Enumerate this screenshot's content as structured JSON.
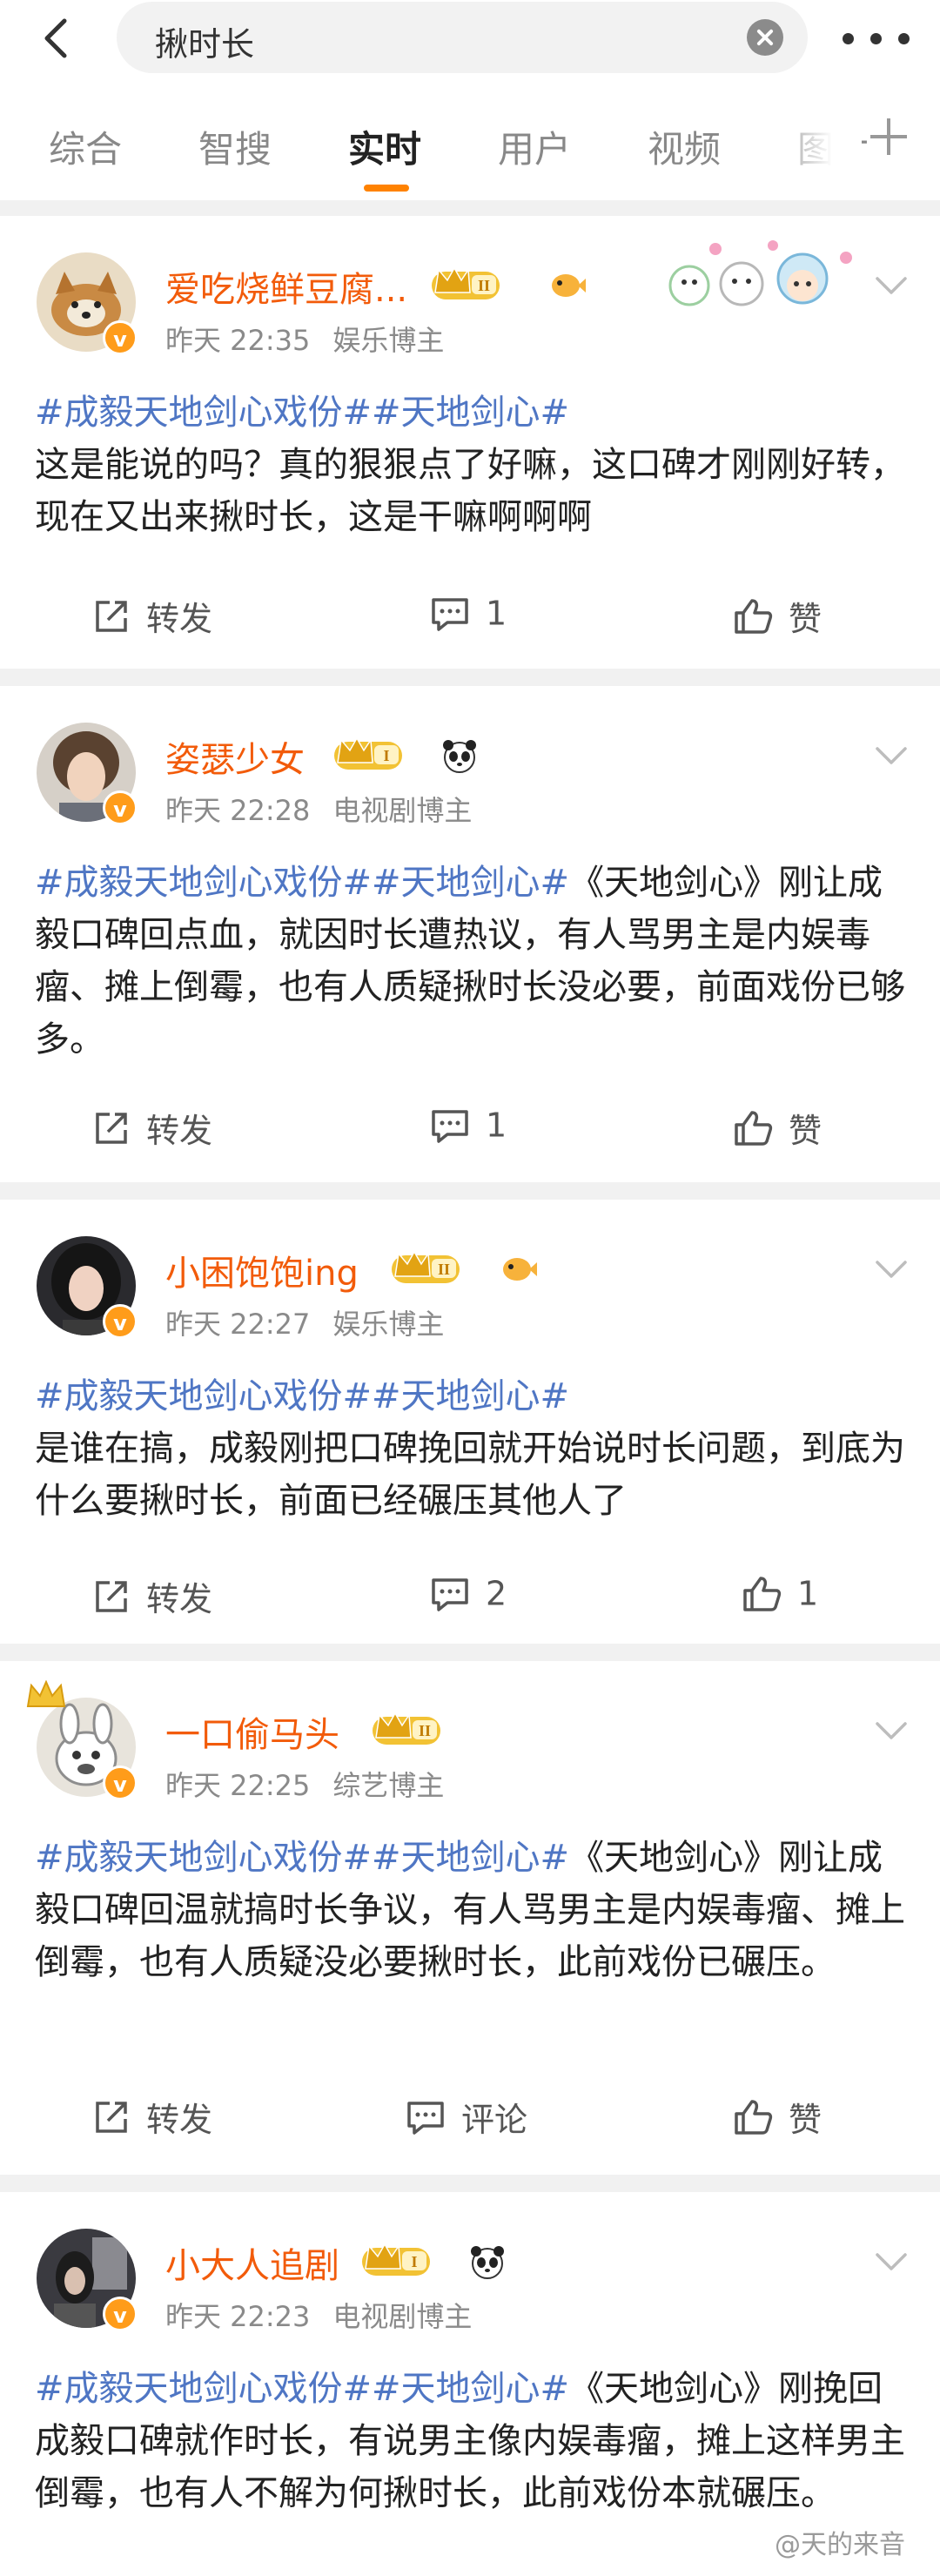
{
  "search": {
    "query": "揪时长"
  },
  "tabs": [
    "综合",
    "智搜",
    "实时",
    "用户",
    "视频",
    "图片"
  ],
  "active_tab": "实时",
  "accent_color": "#ff8200",
  "username_color": "#f25b0a",
  "hashtag_color": "#4f76c4",
  "posts": [
    {
      "username": "爱吃烧鲜豆腐...",
      "time": "昨天 22:35",
      "role": "娱乐博主",
      "level": "II",
      "hashtags": "#成毅天地剑心戏份##天地剑心#",
      "text": "这是能说的吗？真的狠狠点了好嘛，这口碑才刚刚好转，现在又出来揪时长，这是干嘛啊啊啊",
      "repost": "转发",
      "comment": "1",
      "like": "赞"
    },
    {
      "username": "姿瑟少女",
      "time": "昨天 22:28",
      "role": "电视剧博主",
      "level": "I",
      "hashtags": "#成毅天地剑心戏份##天地剑心#",
      "text": "《天地剑心》刚让成毅口碑回点血，就因时长遭热议，有人骂男主是内娱毒瘤、摊上倒霉，也有人质疑揪时长没必要，前面戏份已够多。",
      "repost": "转发",
      "comment": "1",
      "like": "赞"
    },
    {
      "username": "小困饱饱ing",
      "time": "昨天 22:27",
      "role": "娱乐博主",
      "level": "II",
      "hashtags": "#成毅天地剑心戏份##天地剑心#",
      "text": "是谁在搞，成毅刚把口碑挽回就开始说时长问题，到底为什么要揪时长，前面已经碾压其他人了",
      "repost": "转发",
      "comment": "2",
      "like": "1"
    },
    {
      "username": "一口偷马头",
      "time": "昨天 22:25",
      "role": "综艺博主",
      "level": "II",
      "hashtags": "#成毅天地剑心戏份##天地剑心#",
      "text": "《天地剑心》刚让成毅口碑回温就搞时长争议，有人骂男主是内娱毒瘤、摊上倒霉，也有人质疑没必要揪时长，此前戏份已碾压。",
      "repost": "转发",
      "comment": "评论",
      "like": "赞"
    },
    {
      "username": "小大人追剧",
      "time": "昨天 22:23",
      "role": "电视剧博主",
      "level": "I",
      "hashtags": "#成毅天地剑心戏份##天地剑心#",
      "text": "《天地剑心》刚挽回成毅口碑就作时长，有说男主像内娱毒瘤，摊上这样男主倒霉，也有人不解为何揪时长，此前戏份本就碾压。"
    }
  ],
  "watermark": "@天的来音"
}
